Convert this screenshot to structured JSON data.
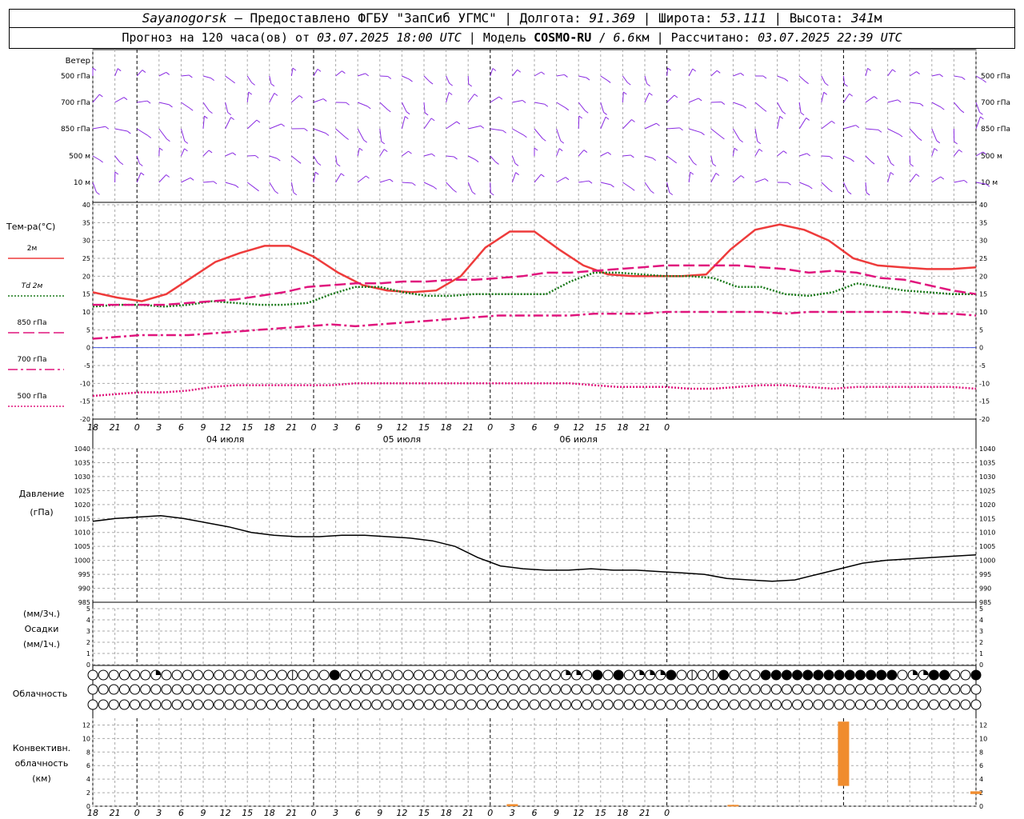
{
  "header": {
    "city": "Sayanogorsk",
    "dash": " — ",
    "provider": "Предоставлено ФГБУ \"ЗапСиб УГМС\"",
    "sep": " | ",
    "lon_label": "Долгота: ",
    "lon": "91.369",
    "lat_label": "Широта: ",
    "lat": "53.111",
    "alt_label": "Высота: ",
    "alt": "341",
    "alt_unit": "м"
  },
  "subheader": {
    "forecast_label": "Прогноз на 120 часа(ов) от ",
    "forecast_start": "03.07.2025 18:00 UTC",
    "model_label": "  | Модель ",
    "model": "COSMO-RU",
    "model_sep": " / ",
    "model_res": "6.6",
    "model_res_unit": "км",
    "calc_label": " | Рассчитано: ",
    "calc_time": "03.07.2025 22:39 UTC"
  },
  "wind_panel": {
    "title": "Ветер",
    "levels": [
      "500 гПа",
      "700 гПа",
      "850 гПа",
      "500 м",
      "10  м"
    ],
    "colors": {
      "barb": "#8a2be2"
    }
  },
  "temp_panel": {
    "title": "Тем-ра(°С)",
    "ylim": [
      -20,
      40
    ],
    "yticks": [
      -20,
      -15,
      -10,
      -5,
      0,
      5,
      10,
      15,
      20,
      25,
      30,
      35,
      40
    ],
    "legend": [
      {
        "label": "2м",
        "color": "#ee3b3b",
        "dash": "solid"
      },
      {
        "label": "Td  2м",
        "color": "#1a7a1a",
        "dash": "dot"
      },
      {
        "label": "850 гПа",
        "color": "#e0157d",
        "dash": "long"
      },
      {
        "label": "700 гПа",
        "color": "#e0157d",
        "dash": "dashdot"
      },
      {
        "label": "500 гПа",
        "color": "#e0157d",
        "dash": "dot"
      }
    ]
  },
  "time_axis": {
    "hour_labels": [
      "18",
      "21",
      "0",
      "3",
      "6",
      "9",
      "12",
      "15",
      "18",
      "21",
      "0",
      "3",
      "6",
      "9",
      "12",
      "15",
      "18",
      "21",
      "0",
      "3",
      "6",
      "9",
      "12",
      "15",
      "18",
      "21",
      "0"
    ],
    "day_labels": [
      "04 июля",
      "05 июля",
      "06 июля"
    ]
  },
  "pressure_panel": {
    "title": "Давление",
    "unit": "(гПа)",
    "ylim": [
      985,
      1040
    ],
    "yticks": [
      985,
      990,
      995,
      1000,
      1005,
      1010,
      1015,
      1020,
      1025,
      1030,
      1035,
      1040
    ]
  },
  "precip_panel": {
    "unit1": "(мм/3ч.)",
    "title": "Осадки",
    "unit2": "(мм/1ч.)",
    "yticks": [
      0,
      1,
      2,
      3,
      4,
      5
    ]
  },
  "cloud_panel": {
    "title": "Облачность"
  },
  "conv_panel": {
    "title1": "Конвективн.",
    "title2": "облачность",
    "unit": "(км)",
    "ylim": [
      0,
      13
    ],
    "yticks": [
      0,
      2,
      4,
      6,
      8,
      10,
      12
    ],
    "color": "#f08c2e"
  },
  "chart_data": {
    "type": "line",
    "x_hours_from_start": [
      0,
      3,
      6,
      9,
      12,
      15,
      18,
      21,
      24,
      27,
      30,
      33,
      36,
      39,
      42,
      45,
      48,
      51,
      54,
      57,
      60,
      63,
      66,
      69,
      72,
      75,
      78,
      81,
      84,
      87,
      90,
      93,
      96,
      99,
      102,
      105,
      108,
      111,
      114,
      117,
      120
    ],
    "series": [
      {
        "name": "2м",
        "values": [
          15.5,
          14,
          13,
          15,
          19.5,
          24,
          26.5,
          28.5,
          28.5,
          25.5,
          21,
          17.5,
          16,
          15.5,
          16,
          20,
          28,
          32.5,
          32.5,
          27.5,
          23,
          20.5,
          20,
          20,
          20,
          20.5,
          27.5,
          33,
          34.5,
          33,
          30,
          25,
          23,
          22.5,
          22,
          22,
          22.5
        ]
      },
      {
        "name": "Td  2м",
        "values": [
          11.5,
          12,
          12,
          11.5,
          12,
          13,
          12.5,
          12,
          12,
          12.5,
          15,
          17,
          17,
          15.5,
          14.5,
          14.5,
          15,
          15,
          15,
          15,
          18.5,
          21,
          21,
          20.5,
          20,
          20,
          19.5,
          17,
          17,
          15,
          14.5,
          15.5,
          18,
          17,
          16,
          15.5,
          15,
          15
        ]
      },
      {
        "name": "850 гПа",
        "values": [
          12,
          12,
          12,
          12,
          12.5,
          13,
          13.5,
          14.5,
          15.5,
          17,
          17.5,
          18,
          18,
          18.5,
          18.5,
          19,
          19,
          19.5,
          20,
          21,
          21,
          21.5,
          22,
          22.5,
          23,
          23,
          23,
          23,
          22.5,
          22,
          21,
          21.5,
          21,
          19.5,
          19,
          17.5,
          16,
          15
        ]
      },
      {
        "name": "700 гПа",
        "values": [
          2.5,
          3,
          3.5,
          3.5,
          3.5,
          4,
          4.5,
          5,
          5.5,
          6,
          6.5,
          6,
          6.5,
          7,
          7.5,
          8,
          8.5,
          9,
          9,
          9,
          9,
          9.5,
          9.5,
          9.5,
          10,
          10,
          10,
          10,
          10,
          9.5,
          10,
          10,
          10,
          10,
          10,
          9.5,
          9.5,
          9
        ]
      },
      {
        "name": "500 гПа",
        "values": [
          -13.5,
          -13,
          -12.5,
          -12.5,
          -12,
          -11,
          -10.5,
          -10.5,
          -10.5,
          -10.5,
          -10.5,
          -10,
          -10,
          -10,
          -10,
          -10,
          -10,
          -10,
          -10,
          -10,
          -10,
          -10.5,
          -11,
          -11,
          -11,
          -11.5,
          -11.5,
          -11,
          -10.5,
          -10.5,
          -11,
          -11.5,
          -11,
          -11,
          -11,
          -11,
          -11,
          -11.5
        ]
      },
      {
        "name": "Давление",
        "values": [
          1014,
          1015,
          1015.5,
          1016,
          1015,
          1013.5,
          1012,
          1010,
          1009,
          1008.5,
          1008.5,
          1009,
          1009,
          1008.5,
          1008,
          1007,
          1005,
          1001,
          998,
          997,
          996.5,
          996.5,
          997,
          996.5,
          996.5,
          996,
          995.5,
          995,
          993.5,
          993,
          992.5,
          993,
          995,
          997,
          999,
          1000,
          1000.5,
          1001,
          1001.5,
          1002
        ]
      },
      {
        "name": "Конвективн. облачность",
        "bars": [
          {
            "hour": 57,
            "low": 0,
            "high": 0.3
          },
          {
            "hour": 87,
            "low": 0,
            "high": 0.2
          },
          {
            "hour": 102,
            "low": 3,
            "high": 12.5
          },
          {
            "hour": 120,
            "low": 1.8,
            "high": 2.2
          }
        ]
      }
    ],
    "cloud_rows": {
      "upper": "0000003000000000000200040000000000000000000003304040333402024000444444444444403344004",
      "middle": "0000000000000000000000000000000000000000000000000000000000000000000000000000000000000",
      "lower": "0000000000000000000000000000000000000000000000000000000000000000000000000000000000000"
    },
    "ylim_temp": [
      -20,
      40
    ],
    "ylim_pressure": [
      985,
      1040
    ],
    "grid": true
  }
}
